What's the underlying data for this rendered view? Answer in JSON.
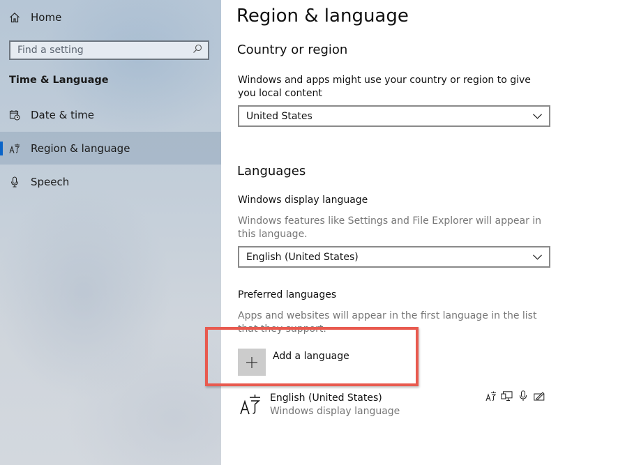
{
  "sidebar": {
    "home_label": "Home",
    "search_placeholder": "Find a setting",
    "section_title": "Time & Language",
    "items": [
      {
        "label": "Date & time",
        "icon": "calendar-clock-icon"
      },
      {
        "label": "Region & language",
        "icon": "language-icon",
        "selected": true
      },
      {
        "label": "Speech",
        "icon": "microphone-icon"
      }
    ]
  },
  "main": {
    "title": "Region & language",
    "country": {
      "heading": "Country or region",
      "description": "Windows and apps might use your country or region to give you local content",
      "selected": "United States"
    },
    "languages": {
      "heading": "Languages",
      "display_language_label": "Windows display language",
      "display_language_description": "Windows features like Settings and File Explorer will appear in this language.",
      "display_language_selected": "English (United States)",
      "preferred_label": "Preferred languages",
      "preferred_description": "Apps and websites will appear in the first language in the list that they support.",
      "add_language_label": "Add a language",
      "items": [
        {
          "name": "English (United States)",
          "subtitle": "Windows display language",
          "feature_icons": [
            "language-pack-icon",
            "display-icon",
            "speech-icon",
            "handwriting-icon"
          ]
        }
      ]
    }
  },
  "colors": {
    "accent": "#0a64c8",
    "highlight_border": "#e85a4f",
    "plus_tile": "#cccccc"
  }
}
